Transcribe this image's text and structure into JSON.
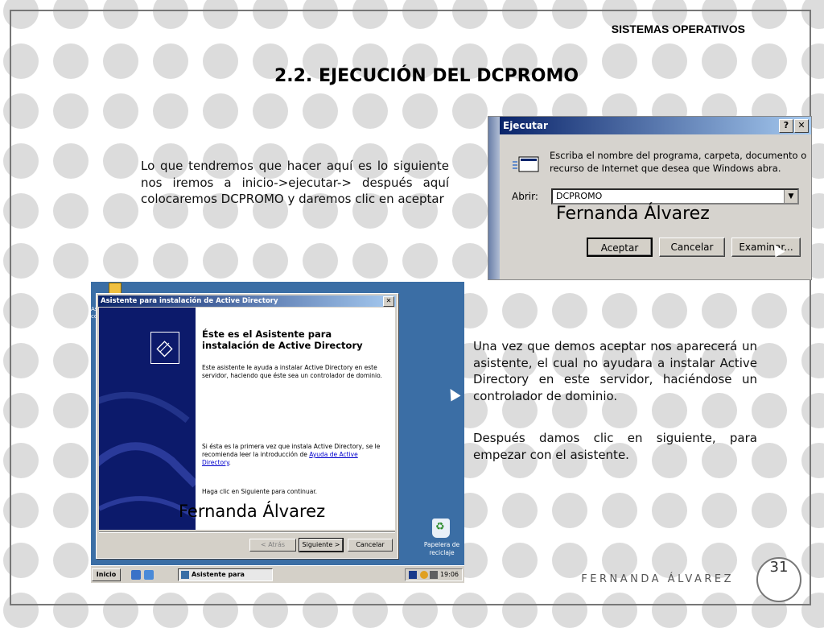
{
  "header": {
    "label": "SISTEMAS OPERATIVOS"
  },
  "slide": {
    "title": "2.2. EJECUCIÓN DEL DCPROMO",
    "paragraphs": [
      "Lo que tendremos que hacer aquí es lo siguiente nos iremos a inicio->ejecutar-> después aquí colocaremos DCPROMO y daremos clic en aceptar",
      "Una vez que demos aceptar nos aparecerá un asistente, el cual  no ayudara a instalar Active Directory en este servidor, haciéndose un controlador de dominio.",
      "Después damos clic en siguiente, para empezar con el asistente."
    ]
  },
  "run_dialog": {
    "title": "Ejecutar",
    "help_btn": "?",
    "close_btn": "✕",
    "description": "Escriba el nombre del programa, carpeta, documento o recurso de Internet que desea que Windows abra.",
    "open_label": "Abrir:",
    "input_value": "DCPROMO",
    "dropdown_arrow": "▼",
    "watermark": "Fernanda Álvarez",
    "buttons": {
      "accept": "Aceptar",
      "cancel": "Cancelar",
      "browse": "Examinar..."
    }
  },
  "wizard": {
    "title": "Asistente para instalación de Active Directory",
    "close_btn": "✕",
    "heading": "Éste es el Asistente para instalación de Active Directory",
    "intro": "Este asistente le ayuda a instalar Active Directory en este servidor, haciendo que éste sea un controlador de dominio.",
    "first_time": "Si ésta es la primera vez que instala Active Directory, se le recomienda leer la introducción de ",
    "help_link": "Ayuda de Active Directory",
    "first_time_end": ".",
    "continue": "Haga clic en Siguiente para continuar.",
    "watermark": "Fernanda Álvarez",
    "buttons": {
      "back": "< Atrás",
      "next": "Siguiente >",
      "cancel": "Cancelar"
    }
  },
  "desktop": {
    "left_text": "As co",
    "recycle_label": "Papelera de reciclaje",
    "recycle_symbol": "♻",
    "taskbar": {
      "start": "Inicio",
      "task_button": "Asistente para instal...",
      "clock": "19:06"
    }
  },
  "footer": {
    "author": "FERNANDA ÁLVAREZ",
    "page_number": "31"
  }
}
